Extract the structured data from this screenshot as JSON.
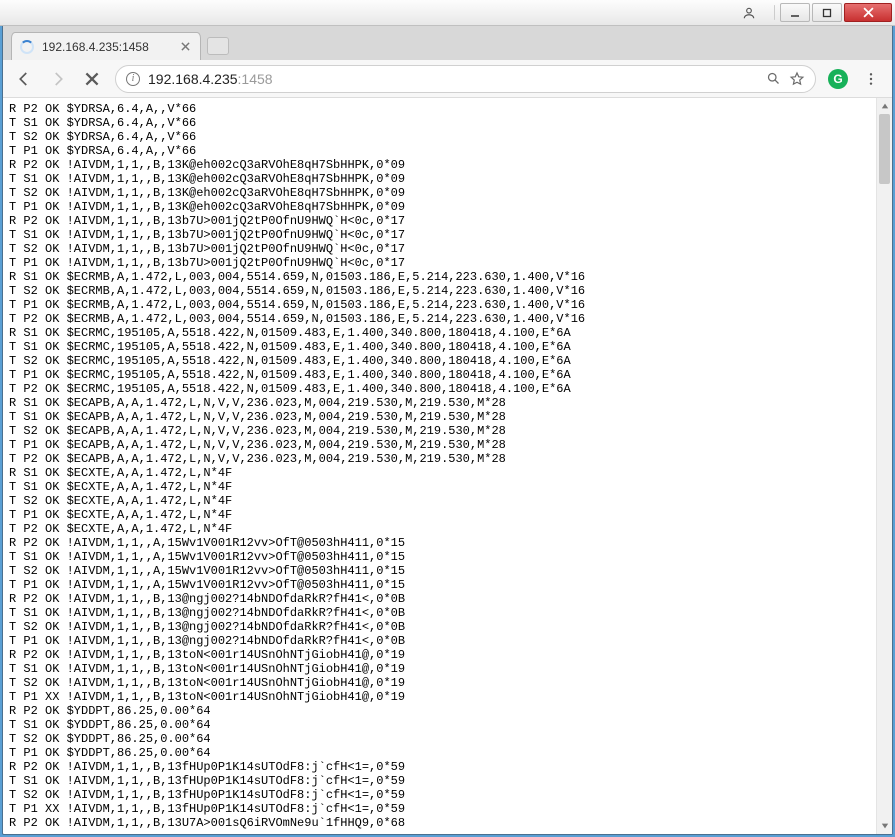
{
  "window": {
    "user_tooltip": "User",
    "minimize_tooltip": "Minimize",
    "maximize_tooltip": "Maximize",
    "close_tooltip": "Close"
  },
  "tab": {
    "title": "192.168.4.235:1458",
    "close_tooltip": "Close tab"
  },
  "toolbar": {
    "back_tooltip": "Back",
    "forward_tooltip": "Forward",
    "stop_tooltip": "Stop",
    "url_main": "192.168.4.235",
    "url_rest": ":1458",
    "search_tooltip": "Search",
    "star_tooltip": "Bookmark this page",
    "ext_label": "G",
    "menu_tooltip": "Customize and control"
  },
  "lines": [
    "R P2 OK $YDRSA,6.4,A,,V*66",
    "T S1 OK $YDRSA,6.4,A,,V*66",
    "T S2 OK $YDRSA,6.4,A,,V*66",
    "T P1 OK $YDRSA,6.4,A,,V*66",
    "R P2 OK !AIVDM,1,1,,B,13K@eh002cQ3aRVOhE8qH7SbHHPK,0*09",
    "T S1 OK !AIVDM,1,1,,B,13K@eh002cQ3aRVOhE8qH7SbHHPK,0*09",
    "T S2 OK !AIVDM,1,1,,B,13K@eh002cQ3aRVOhE8qH7SbHHPK,0*09",
    "T P1 OK !AIVDM,1,1,,B,13K@eh002cQ3aRVOhE8qH7SbHHPK,0*09",
    "R P2 OK !AIVDM,1,1,,B,13b7U>001jQ2tP0OfnU9HWQ`H<0c,0*17",
    "T S1 OK !AIVDM,1,1,,B,13b7U>001jQ2tP0OfnU9HWQ`H<0c,0*17",
    "T S2 OK !AIVDM,1,1,,B,13b7U>001jQ2tP0OfnU9HWQ`H<0c,0*17",
    "T P1 OK !AIVDM,1,1,,B,13b7U>001jQ2tP0OfnU9HWQ`H<0c,0*17",
    "R S1 OK $ECRMB,A,1.472,L,003,004,5514.659,N,01503.186,E,5.214,223.630,1.400,V*16",
    "T S2 OK $ECRMB,A,1.472,L,003,004,5514.659,N,01503.186,E,5.214,223.630,1.400,V*16",
    "T P1 OK $ECRMB,A,1.472,L,003,004,5514.659,N,01503.186,E,5.214,223.630,1.400,V*16",
    "T P2 OK $ECRMB,A,1.472,L,003,004,5514.659,N,01503.186,E,5.214,223.630,1.400,V*16",
    "R S1 OK $ECRMC,195105,A,5518.422,N,01509.483,E,1.400,340.800,180418,4.100,E*6A",
    "T S1 OK $ECRMC,195105,A,5518.422,N,01509.483,E,1.400,340.800,180418,4.100,E*6A",
    "T S2 OK $ECRMC,195105,A,5518.422,N,01509.483,E,1.400,340.800,180418,4.100,E*6A",
    "T P1 OK $ECRMC,195105,A,5518.422,N,01509.483,E,1.400,340.800,180418,4.100,E*6A",
    "T P2 OK $ECRMC,195105,A,5518.422,N,01509.483,E,1.400,340.800,180418,4.100,E*6A",
    "R S1 OK $ECAPB,A,A,1.472,L,N,V,V,236.023,M,004,219.530,M,219.530,M*28",
    "T S1 OK $ECAPB,A,A,1.472,L,N,V,V,236.023,M,004,219.530,M,219.530,M*28",
    "T S2 OK $ECAPB,A,A,1.472,L,N,V,V,236.023,M,004,219.530,M,219.530,M*28",
    "T P1 OK $ECAPB,A,A,1.472,L,N,V,V,236.023,M,004,219.530,M,219.530,M*28",
    "T P2 OK $ECAPB,A,A,1.472,L,N,V,V,236.023,M,004,219.530,M,219.530,M*28",
    "R S1 OK $ECXTE,A,A,1.472,L,N*4F",
    "T S1 OK $ECXTE,A,A,1.472,L,N*4F",
    "T S2 OK $ECXTE,A,A,1.472,L,N*4F",
    "T P1 OK $ECXTE,A,A,1.472,L,N*4F",
    "T P2 OK $ECXTE,A,A,1.472,L,N*4F",
    "R P2 OK !AIVDM,1,1,,A,15Wv1V001R12vv>OfT@0503hH411,0*15",
    "T S1 OK !AIVDM,1,1,,A,15Wv1V001R12vv>OfT@0503hH411,0*15",
    "T S2 OK !AIVDM,1,1,,A,15Wv1V001R12vv>OfT@0503hH411,0*15",
    "T P1 OK !AIVDM,1,1,,A,15Wv1V001R12vv>OfT@0503hH411,0*15",
    "R P2 OK !AIVDM,1,1,,B,13@ngj002?14bNDOfdaRkR?fH41<,0*0B",
    "T S1 OK !AIVDM,1,1,,B,13@ngj002?14bNDOfdaRkR?fH41<,0*0B",
    "T S2 OK !AIVDM,1,1,,B,13@ngj002?14bNDOfdaRkR?fH41<,0*0B",
    "T P1 OK !AIVDM,1,1,,B,13@ngj002?14bNDOfdaRkR?fH41<,0*0B",
    "R P2 OK !AIVDM,1,1,,B,13toN<001r14USnOhNTjGiobH41@,0*19",
    "T S1 OK !AIVDM,1,1,,B,13toN<001r14USnOhNTjGiobH41@,0*19",
    "T S2 OK !AIVDM,1,1,,B,13toN<001r14USnOhNTjGiobH41@,0*19",
    "T P1 XX !AIVDM,1,1,,B,13toN<001r14USnOhNTjGiobH41@,0*19",
    "R P2 OK $YDDPT,86.25,0.00*64",
    "T S1 OK $YDDPT,86.25,0.00*64",
    "T S2 OK $YDDPT,86.25,0.00*64",
    "T P1 OK $YDDPT,86.25,0.00*64",
    "R P2 OK !AIVDM,1,1,,B,13fHUp0P1K14sUTOdF8:j`cfH<1=,0*59",
    "T S1 OK !AIVDM,1,1,,B,13fHUp0P1K14sUTOdF8:j`cfH<1=,0*59",
    "T S2 OK !AIVDM,1,1,,B,13fHUp0P1K14sUTOdF8:j`cfH<1=,0*59",
    "T P1 XX !AIVDM,1,1,,B,13fHUp0P1K14sUTOdF8:j`cfH<1=,0*59",
    "R P2 OK !AIVDM,1,1,,B,13U7A>001sQ6iRVOmNe9u`1fHHQ9,0*68"
  ]
}
